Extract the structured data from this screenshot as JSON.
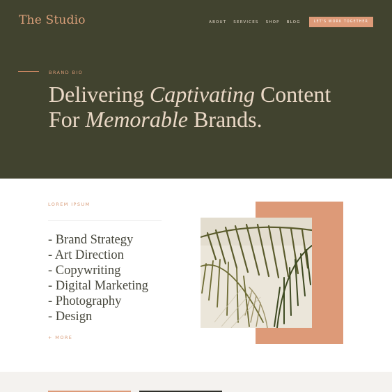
{
  "header": {
    "logo": "The Studio",
    "nav": [
      "ABOUT",
      "SERVICES",
      "SHOP",
      "BLOG"
    ],
    "cta": "LET'S WORK TOGETHER"
  },
  "hero": {
    "eyebrow": "BRAND BIO",
    "title_1a": "Delivering ",
    "title_1b": "Captivating",
    "title_1c": " Content",
    "title_2a": "For ",
    "title_2b": "Memorable",
    "title_2c": " Brands."
  },
  "services": {
    "eyebrow": "LOREM IPSUM",
    "items": [
      "- Brand Strategy",
      "- Art Direction",
      "- Copywriting",
      "- Digital Marketing",
      "- Photography",
      "- Design"
    ],
    "more": "+ MORE"
  },
  "colors": {
    "hero_bg": "#41432f",
    "accent": "#dd9a78",
    "hero_text": "#ead8c6",
    "body_text": "#47473c"
  }
}
